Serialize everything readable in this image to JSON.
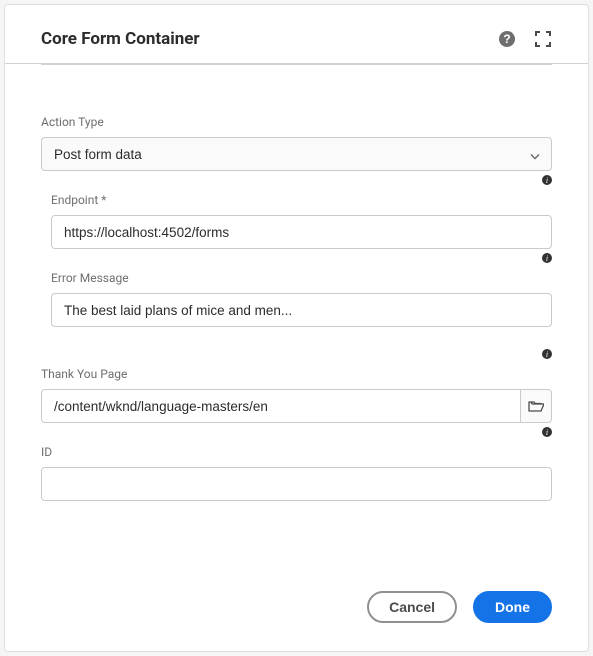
{
  "dialog": {
    "title": "Core Form Container"
  },
  "fields": {
    "actionType": {
      "label": "Action Type",
      "value": "Post form data"
    },
    "endpoint": {
      "label": "Endpoint *",
      "value": "https://localhost:4502/forms"
    },
    "errorMessage": {
      "label": "Error Message",
      "value": "The best laid plans of mice and men..."
    },
    "thankYouPage": {
      "label": "Thank You Page",
      "value": "/content/wknd/language-masters/en"
    },
    "id": {
      "label": "ID",
      "value": ""
    }
  },
  "buttons": {
    "cancel": "Cancel",
    "done": "Done"
  }
}
